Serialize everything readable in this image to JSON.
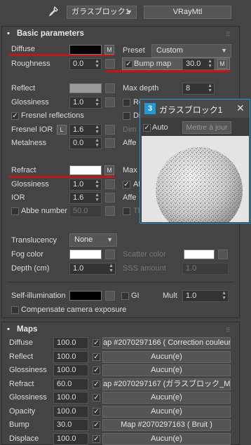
{
  "toolbar": {
    "material_name": "ガラスブロック1",
    "material_type": "VRayMtl"
  },
  "basic": {
    "title": "Basic parameters",
    "diffuse_label": "Diffuse",
    "diffuse_color": "#000000",
    "m": "M",
    "roughness_label": "Roughness",
    "roughness_value": "0.0",
    "preset_label": "Preset",
    "preset_value": "Custom",
    "bump_label": "Bump map",
    "bump_value": "30.0",
    "reflect_label": "Reflect",
    "reflect_color": "#9a9a9a",
    "glossiness_label": "Glossiness",
    "glossiness_value": "1.0",
    "fresnel_label": "Fresnel reflections",
    "fresnel_ior_label": "Fresnel IOR",
    "fresnel_l": "L",
    "fresnel_ior_value": "1.6",
    "metalness_label": "Metalness",
    "metalness_value": "0.0",
    "max_depth_label": "Max depth",
    "max_depth_value": "8",
    "re_trunc": "Re",
    "di_trunc": "Di",
    "dim_trunc": "Dim",
    "affe_trunc": "Affe",
    "refract_label": "Refract",
    "refract_color": "#ffffff",
    "max_trunc": "Max",
    "r_glossiness_label": "Glossiness",
    "r_glossiness_value": "1.0",
    "ior_label": "IOR",
    "ior_value": "1.6",
    "abbe_label": "Abbe number",
    "abbe_value": "50.0",
    "af_trunc": "Af",
    "affe2_trunc": "Affe",
    "th_trunc": "Th",
    "translucency_label": "Translucency",
    "translucency_value": "None",
    "fog_label": "Fog color",
    "fog_color": "#ffffff",
    "scatter_label": "Scatter color",
    "scatter_color": "#ffffff",
    "depth_label": "Depth (cm)",
    "depth_value": "1.0",
    "sss_label": "SSS amount",
    "sss_value": "1.0",
    "selfillum_label": "Self-illumination",
    "selfillum_color": "#000000",
    "gi_label": "GI",
    "mult_label": "Mult",
    "mult_value": "1.0",
    "comp_label": "Compensate camera exposure"
  },
  "popup": {
    "badge": "3",
    "title": "ガラスブロック1",
    "close": "✕",
    "auto_label": "Auto",
    "update_label": "Mettre à jour"
  },
  "maps": {
    "title": "Maps",
    "rows": [
      {
        "label": "Diffuse",
        "value": "100.0",
        "map": "ap #2070297166  ( Correction couleur"
      },
      {
        "label": "Reflect",
        "value": "100.0",
        "map": "Aucun(e)"
      },
      {
        "label": "Glossiness",
        "value": "100.0",
        "map": "Aucun(e)"
      },
      {
        "label": "Refract",
        "value": "60.0",
        "map": "ap #2070297167 (ガラスブロック_M.jp"
      },
      {
        "label": "Glossiness",
        "value": "100.0",
        "map": "Aucun(e)"
      },
      {
        "label": "Opacity",
        "value": "100.0",
        "map": "Aucun(e)"
      },
      {
        "label": "Bump",
        "value": "30.0",
        "map": "Map #2070297163  ( Bruit )"
      },
      {
        "label": "Displace",
        "value": "100.0",
        "map": "Aucun(e)"
      }
    ]
  }
}
